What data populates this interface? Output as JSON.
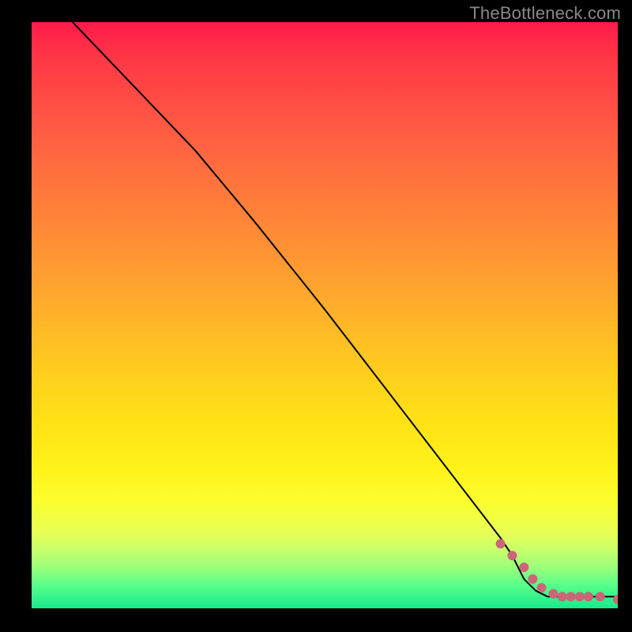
{
  "watermark": "TheBottleneck.com",
  "chart_data": {
    "type": "line",
    "title": "",
    "xlabel": "",
    "ylabel": "",
    "xlim": [
      0,
      100
    ],
    "ylim": [
      0,
      100
    ],
    "background": "vertical-gradient red→orange→yellow→green",
    "series": [
      {
        "name": "curve",
        "color": "#000000",
        "x": [
          7,
          28,
          38,
          50,
          60,
          70,
          80,
          82,
          84,
          86,
          88,
          100
        ],
        "y": [
          100,
          78,
          66,
          51,
          38,
          25,
          12,
          9,
          5,
          3,
          2,
          2
        ]
      }
    ],
    "points": {
      "name": "dots",
      "color": "#cc6677",
      "x": [
        80,
        82,
        84,
        85.5,
        87,
        89,
        90.5,
        92,
        93.5,
        95,
        97,
        100
      ],
      "y": [
        11,
        9,
        7,
        5,
        3.5,
        2.5,
        2,
        2,
        2,
        2,
        2,
        1.5
      ]
    }
  }
}
